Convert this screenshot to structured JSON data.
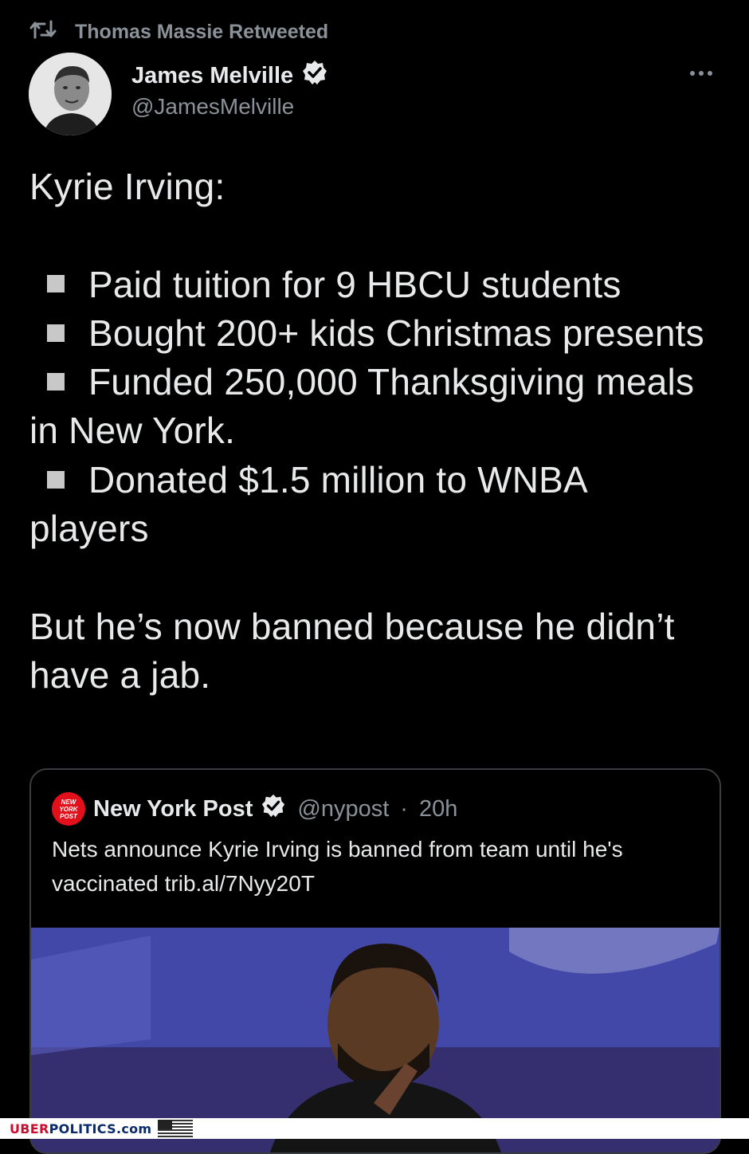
{
  "retweet": {
    "label": "Thomas Massie Retweeted"
  },
  "author": {
    "name": "James Melville",
    "handle": "@JamesMelville"
  },
  "tweet": {
    "title": "Kyrie Irving:",
    "bullets": [
      "Paid tuition for 9 HBCU students",
      "Bought 200+ kids Christmas presents",
      "Funded 250,000 Thanksgiving meals in New York.",
      "Donated $1.5 million to WNBA players"
    ],
    "closing": "But he’s now banned because he didn’t have a jab."
  },
  "quote": {
    "name": "New York Post",
    "handle": "@nypost",
    "time": "20h",
    "separator": "·",
    "text": "Nets announce Kyrie Irving is banned from team until he's vaccinated trib.al/7Nyy20T",
    "logo_text": "NEW YORK POST"
  },
  "watermark": {
    "uber": "UBER",
    "rest": "POLITICS.com"
  },
  "colors": {
    "background": "#000000",
    "text": "#e7e9ea",
    "muted": "#8b9198",
    "verified": "#e7e9ea",
    "nypost_red": "#e3101c"
  },
  "icons": [
    "retweet-icon",
    "verified-icon",
    "more-icon",
    "nypost-logo-icon",
    "us-flag-icon"
  ]
}
